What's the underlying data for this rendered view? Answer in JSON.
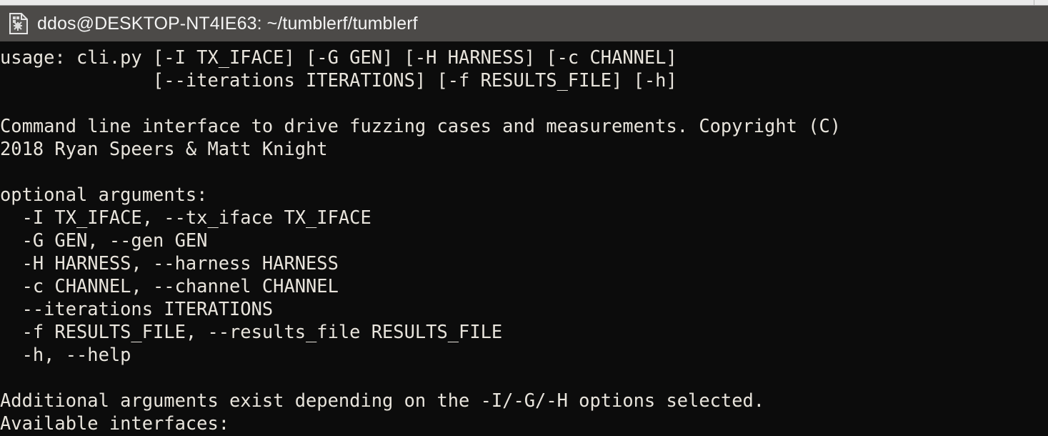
{
  "window": {
    "title": "ddos@DESKTOP-NT4IE63: ~/tumblerf/tumblerf",
    "icon": "wsl-terminal-icon",
    "titlebar_color": "#4c4a48",
    "titlebar_text_color": "#f4f4f4",
    "terminal_bg_color": "#0c0c0c",
    "terminal_fg_color": "#e8e4dc",
    "desktop_strip_color": "#eaeaea"
  },
  "terminal": {
    "lines": [
      "usage: cli.py [-I TX_IFACE] [-G GEN] [-H HARNESS] [-c CHANNEL]",
      "              [--iterations ITERATIONS] [-f RESULTS_FILE] [-h]",
      "",
      "Command line interface to drive fuzzing cases and measurements. Copyright (C)",
      "2018 Ryan Speers & Matt Knight",
      "",
      "optional arguments:",
      "  -I TX_IFACE, --tx_iface TX_IFACE",
      "  -G GEN, --gen GEN",
      "  -H HARNESS, --harness HARNESS",
      "  -c CHANNEL, --channel CHANNEL",
      "  --iterations ITERATIONS",
      "  -f RESULTS_FILE, --results_file RESULTS_FILE",
      "  -h, --help",
      "",
      "Additional arguments exist depending on the -I/-G/-H options selected.",
      "Available interfaces:"
    ]
  }
}
